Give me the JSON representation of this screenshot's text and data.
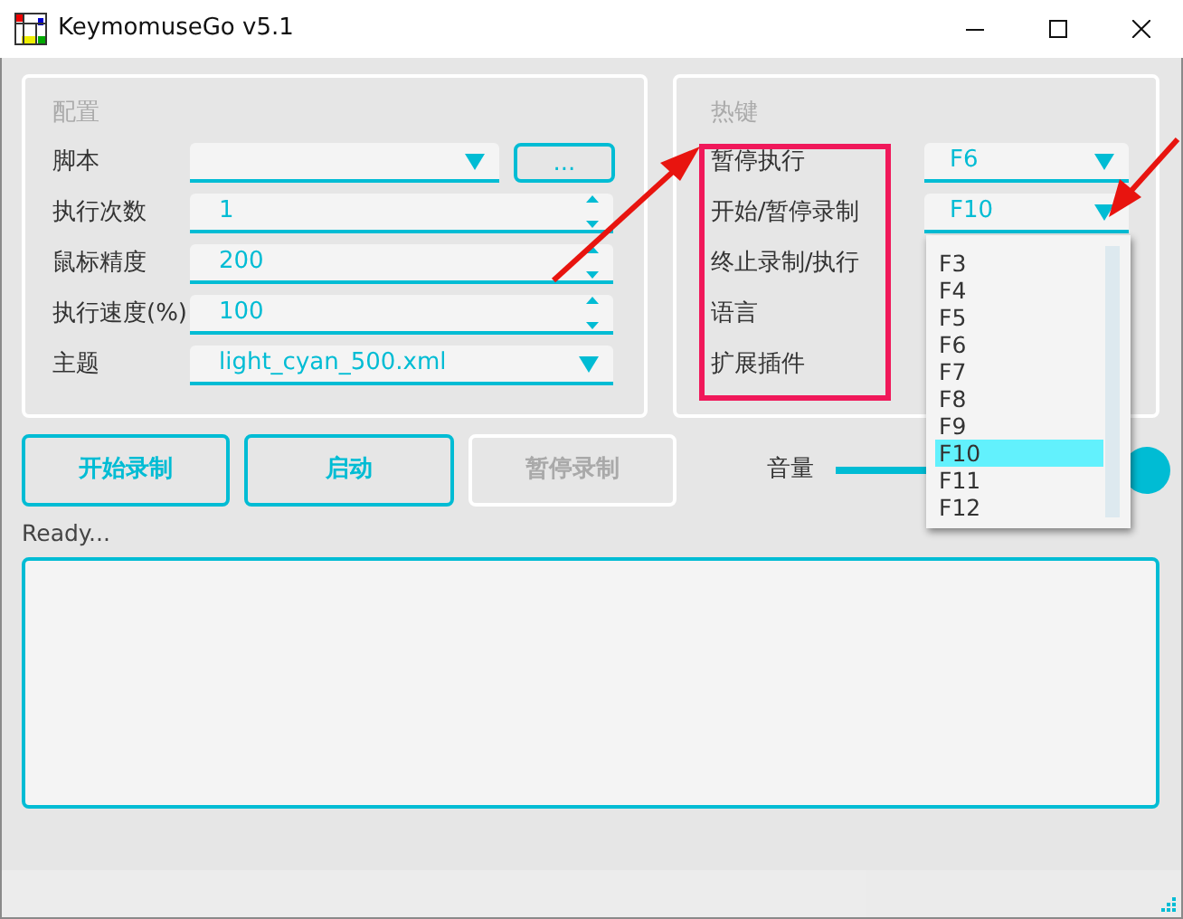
{
  "window": {
    "title": "KeymomuseGo v5.1"
  },
  "config": {
    "title": "配置",
    "browse_button": "...",
    "rows": [
      {
        "label": "脚本",
        "kind": "combo",
        "value": ""
      },
      {
        "label": "执行次数",
        "kind": "spin",
        "value": "1"
      },
      {
        "label": "鼠标精度",
        "kind": "spin",
        "value": "200"
      },
      {
        "label": "执行速度(%)",
        "kind": "spin",
        "value": "100"
      },
      {
        "label": "主题",
        "kind": "combo",
        "value": "light_cyan_500.xml"
      }
    ]
  },
  "hotkeys": {
    "title": "热键",
    "rows": [
      {
        "label": "暂停执行",
        "value": "F6"
      },
      {
        "label": "开始/暂停录制",
        "value": "F10",
        "expanded": true
      },
      {
        "label": "终止录制/执行"
      },
      {
        "label": "语言"
      },
      {
        "label": "扩展插件"
      }
    ],
    "dropdown": [
      {
        "label": "F3",
        "selected": false
      },
      {
        "label": "F4",
        "selected": false
      },
      {
        "label": "F5",
        "selected": false
      },
      {
        "label": "F6",
        "selected": false
      },
      {
        "label": "F7",
        "selected": false
      },
      {
        "label": "F8",
        "selected": false
      },
      {
        "label": "F9",
        "selected": false
      },
      {
        "label": "F10",
        "selected": true
      },
      {
        "label": "F11",
        "selected": false
      },
      {
        "label": "F12",
        "selected": false
      }
    ]
  },
  "buttons": [
    {
      "label": "开始录制",
      "disabled": false
    },
    {
      "label": "启动",
      "disabled": false
    },
    {
      "label": "暂停录制",
      "disabled": true
    }
  ],
  "volume": {
    "label": "音量",
    "level": 0.96
  },
  "status": "Ready..."
}
